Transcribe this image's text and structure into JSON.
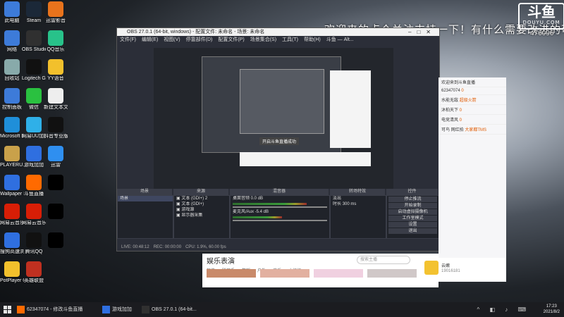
{
  "wallpaper": {
    "overlay_text": "欢迎来的点个关注支持一下！有什么需要改进的可以说",
    "overlay_id": "476096",
    "logo_text": "斗鱼",
    "logo_sub": "DOUYU.COM"
  },
  "desktop_icons": [
    {
      "label": "此电脑",
      "color": "#3d7bd9"
    },
    {
      "label": "Steam",
      "color": "#1b2838"
    },
    {
      "label": "迅雷影音",
      "color": "#e8731c"
    },
    {
      "label": "网络",
      "color": "#3d7bd9"
    },
    {
      "label": "OBS Studio",
      "color": "#303030"
    },
    {
      "label": "QQ音乐",
      "color": "#28c28a"
    },
    {
      "label": "回收站",
      "color": "#8aa"
    },
    {
      "label": "Logitech G HUB",
      "color": "#111"
    },
    {
      "label": "YY语音",
      "color": "#f2c02c"
    },
    {
      "label": "控制面板",
      "color": "#3d7bd9"
    },
    {
      "label": "微信",
      "color": "#2ac140"
    },
    {
      "label": "新建文本文档.txt",
      "color": "#eee"
    },
    {
      "label": "Microsoft Edge",
      "color": "#1f8fd9"
    },
    {
      "label": "网易UU加速器",
      "color": "#2fb0e8"
    },
    {
      "label": "抖音专业版",
      "color": "#111"
    },
    {
      "label": "PLAYERU... BATTLEGR...",
      "color": "#c9a14a"
    },
    {
      "label": "游戏加加",
      "color": "#2f6fe0"
    },
    {
      "label": "迅雷",
      "color": "#2f8ff0"
    },
    {
      "label": "Wallpaper Engine",
      "color": "#2f6fe0"
    },
    {
      "label": "斗鱼直播",
      "color": "#ff6a00"
    },
    {
      "label": "",
      "color": "#000"
    },
    {
      "label": "网易云音乐",
      "color": "#d81e06"
    },
    {
      "label": "网易云音乐",
      "color": "#d81e06"
    },
    {
      "label": "",
      "color": "#000"
    },
    {
      "label": "搜狗高速浏览器",
      "color": "#2f6fe0"
    },
    {
      "label": "腾讯QQ",
      "color": "#111"
    },
    {
      "label": "",
      "color": "#000"
    },
    {
      "label": "PotPlayer 64 bit",
      "color": "#f2c02c"
    },
    {
      "label": "英雄联盟",
      "color": "#c03020"
    }
  ],
  "obs": {
    "title": "OBS 27.0.1 (64-bit, windows) - 配置文件: 未命名 - 场景: 未命名",
    "menu": [
      "文件(F)",
      "编辑(E)",
      "视图(V)",
      "停靠部件(D)",
      "配置文件(P)",
      "场景集合(S)",
      "工具(T)",
      "帮助(H)",
      "斗鱼 — Alt..."
    ],
    "preview_ok": "开启斗鱼直播成功",
    "docks": {
      "scenes_header": "场景",
      "sources_header": "来源",
      "mixer_header": "混音器",
      "transitions_header": "转场特效",
      "controls_header": "控件",
      "scenes": [
        "场景"
      ],
      "sources": [
        "文本 (GDI+) 2",
        "文本 (GDI+)",
        "游戏源",
        "显示器采集"
      ],
      "mixer": [
        {
          "name": "桌面音频",
          "db": "0.0 dB",
          "level": 0.82
        },
        {
          "name": "麦克风/Aux",
          "db": "-5.4 dB",
          "level": 0.55
        }
      ],
      "transition": {
        "type": "淡出",
        "duration_label": "时长",
        "duration": "300 ms"
      },
      "controls": [
        "停止推流",
        "开始录制",
        "启动虚拟摄像机",
        "工作室模式",
        "设置",
        "退出"
      ]
    },
    "status": [
      "LIVE: 00:48:12",
      "REC: 00:00:00",
      "CPU: 1.9%, 60.00 fps"
    ]
  },
  "douyu_side": {
    "rows": [
      {
        "name": "欢迎来到斗鱼直播",
        "gift": ""
      },
      {
        "name": "62347074",
        "gift": "0"
      },
      {
        "name": "水能无敌",
        "gift": "超级火箭"
      },
      {
        "name": "沐柏天下",
        "gift": "0"
      },
      {
        "name": "电竞清风",
        "gift": "0"
      },
      {
        "name": "可鸟 网红拍",
        "gift": "大家都TMS"
      }
    ]
  },
  "douyu_bottom": {
    "title": "娱乐表演",
    "tabs": [
      "颜值",
      "脱口秀",
      "舞蹈",
      "户外",
      "音乐",
      "小姐姐"
    ],
    "search_placeholder": "搜索主播"
  },
  "douyu_user": {
    "name": "云嫩",
    "id": "19016181"
  },
  "taskbar": {
    "items": [
      {
        "label": "62347074 - 修改斗鱼直播",
        "color": "#ff6a00"
      },
      {
        "label": "游戏加加",
        "color": "#2f6fe0"
      },
      {
        "label": "OBS 27.0.1 (64-bit...",
        "color": "#303030"
      }
    ],
    "time": "17:23",
    "date": "2021/8/2"
  }
}
